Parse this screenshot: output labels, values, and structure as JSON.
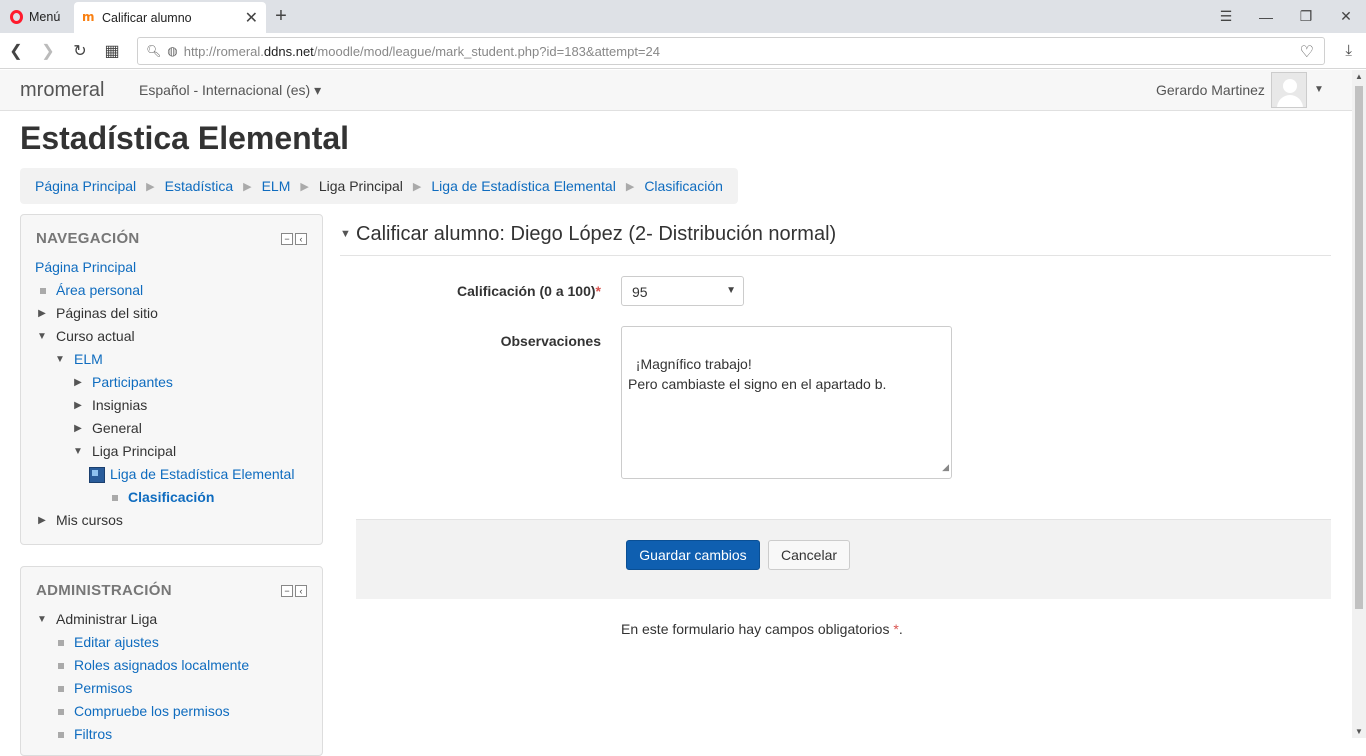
{
  "browser": {
    "menu_label": "Menú",
    "tab_title": "Calificar alumno",
    "url_prefix": "http://romeral.",
    "url_host": "ddns.net",
    "url_path": "/moodle/mod/league/mark_student.php?id=183&attempt=24"
  },
  "navbar": {
    "brand": "mromeral",
    "language": "Español - Internacional (es)",
    "user_name": "Gerardo Martinez"
  },
  "page": {
    "title": "Estadística Elemental"
  },
  "breadcrumb": [
    "Página Principal",
    "Estadística",
    "ELM",
    "Liga Principal",
    "Liga de Estadística Elemental",
    "Clasificación"
  ],
  "navigation_block": {
    "title": "NAVEGACIÓN",
    "items": [
      "Página Principal",
      "Área personal",
      "Páginas del sitio",
      "Curso actual",
      "ELM",
      "Participantes",
      "Insignias",
      "General",
      "Liga Principal",
      "Liga de Estadística Elemental",
      "Clasificación",
      "Mis cursos"
    ]
  },
  "admin_block": {
    "title": "ADMINISTRACIÓN",
    "items": [
      "Administrar Liga",
      "Editar ajustes",
      "Roles asignados localmente",
      "Permisos",
      "Compruebe los permisos",
      "Filtros"
    ]
  },
  "form": {
    "heading": "Calificar alumno: Diego López (2- Distribución normal)",
    "grade_label": "Calificación (0 a 100)",
    "grade_value": "95",
    "obs_label": "Observaciones",
    "obs_value": "¡Magnífico trabajo!\nPero cambiaste el signo en el apartado b.",
    "save_label": "Guardar cambios",
    "cancel_label": "Cancelar",
    "required_note": "En este formulario hay campos obligatorios",
    "required_mark": "*"
  },
  "colors": {
    "link": "#0f6cbf",
    "primary_button": "#0f5fb0",
    "required": "#d9534f"
  }
}
